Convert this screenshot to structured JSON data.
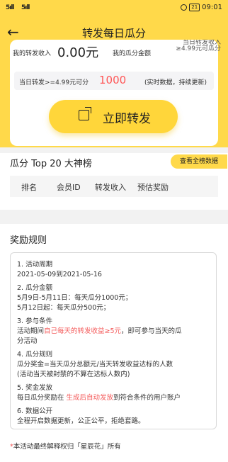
{
  "statusbar": {
    "signal1": "5ıll",
    "signal2": "5ıll",
    "battery": "21",
    "time": "09:01"
  },
  "nav": {
    "back_glyph": "←",
    "title": "转发每日瓜分"
  },
  "card": {
    "my_income_label": "我的转发收入",
    "my_income_value": "0.00元",
    "my_share_label": "我的瓜分金额",
    "note_line1": "当日转发收入",
    "note_line2": "≥4.99元可瓜分",
    "threshold_text": "当日转发>=4.99元可分",
    "pool_value": "1000",
    "realtime_text": "(实时数据，持续更新)",
    "share_button": "立即转发"
  },
  "leaderboard": {
    "title": "瓜分 Top 20 大神榜",
    "view_all": "查看全榜数据",
    "columns": [
      "排名",
      "会员ID",
      "转发收入",
      "预估奖励"
    ]
  },
  "rules": {
    "title": "奖励规则",
    "items": [
      {
        "t": "1. 活动周期"
      },
      {
        "t": "2021-05-09到2021-05-16"
      },
      {
        "t": "2. 瓜分金额"
      },
      {
        "t": "5月9日-5月11日：每天瓜分1000元；"
      },
      {
        "t": "5月12日起：每天瓜分500元；"
      },
      {
        "t": "3. 参与条件"
      },
      {
        "pre": "活动期间",
        "red": "自己每天的转发收益≥5元",
        "post": "，即可参与当天的瓜"
      },
      {
        "t": "分活动"
      },
      {
        "t": "4. 瓜分规则"
      },
      {
        "t": "瓜分奖金=当天瓜分总额元/当天转发收益达标的人数"
      },
      {
        "t": "(活动当天被封禁的不算在达标人数内)"
      },
      {
        "t": "5. 奖金发放"
      },
      {
        "pre": "每日瓜分奖励在 ",
        "red": "生成后自动发放",
        "post": "到符合条件的用户账户"
      },
      {
        "t": "6. 数据公开"
      },
      {
        "t": "全程开启数据更新，公正公平，拒绝套路。"
      }
    ],
    "footer_star": "*",
    "footer": "本活动最终解释权归「星辰花」所有"
  },
  "colors": {
    "accent": "#ffd94a",
    "button": "#ffd63a",
    "highlight": "#f45a5a"
  }
}
